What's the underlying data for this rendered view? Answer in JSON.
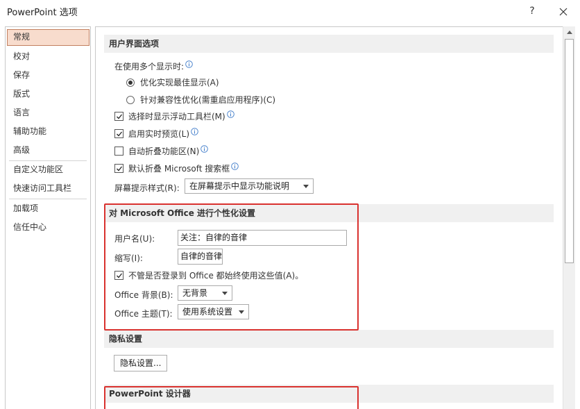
{
  "window": {
    "title": "PowerPoint 选项",
    "help": "?"
  },
  "sidebar": {
    "items": [
      {
        "label": "常规"
      },
      {
        "label": "校对"
      },
      {
        "label": "保存"
      },
      {
        "label": "版式"
      },
      {
        "label": "语言"
      },
      {
        "label": "辅助功能"
      },
      {
        "label": "高级"
      },
      {
        "label": "自定义功能区"
      },
      {
        "label": "快速访问工具栏"
      },
      {
        "label": "加载项"
      },
      {
        "label": "信任中心"
      }
    ]
  },
  "ui_options": {
    "header": "用户界面选项",
    "multi_display_label": "在使用多个显示时:",
    "radio_best": "优化实现最佳显示(A)",
    "radio_compat": "针对兼容性优化(需重启应用程序)(C)",
    "cb_minitoolbar": "选择时显示浮动工具栏(M)",
    "cb_livepreview": "启用实时预览(L)",
    "cb_collapse_ribbon": "自动折叠功能区(N)",
    "cb_collapse_search": "默认折叠 Microsoft 搜索框",
    "screentip_label": "屏幕提示样式(R):",
    "screentip_value": "在屏幕提示中显示功能说明"
  },
  "personalize": {
    "header": "对 Microsoft Office 进行个性化设置",
    "username_label": "用户名(U):",
    "username_value": "关注：自律的音律",
    "initials_label": "缩写(I):",
    "initials_value": "自律的音律",
    "cb_always_use": "不管是否登录到 Office 都始终使用这些值(A)。",
    "background_label": "Office 背景(B):",
    "background_value": "无背景",
    "theme_label": "Office 主题(T):",
    "theme_value": "使用系统设置"
  },
  "privacy": {
    "header": "隐私设置",
    "button": "隐私设置..."
  },
  "designer": {
    "header": "PowerPoint 设计器"
  },
  "colors": {
    "highlight": "#d9312e",
    "active_nav_bg": "#f8dccd",
    "section_bg": "#f0f0f0"
  }
}
